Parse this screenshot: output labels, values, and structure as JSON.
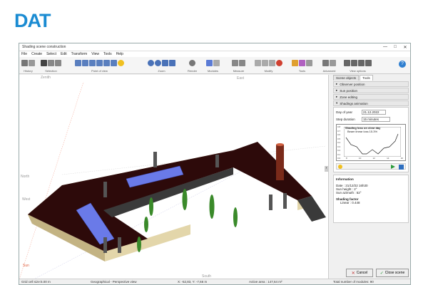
{
  "logo": "DAT",
  "window": {
    "title": "Shading scene construction",
    "controls": [
      "—",
      "□",
      "✕"
    ]
  },
  "menu": [
    "File",
    "Create",
    "Select",
    "Edit",
    "Transform",
    "View",
    "Tools",
    "Help"
  ],
  "toolbar_groups": [
    "History",
    "Selection",
    "Point of view",
    "Zoom",
    "Render",
    "Modules",
    "Measure",
    "Modify",
    "Tools",
    "Advanced",
    "View options"
  ],
  "viewport": {
    "zenith": "Zenith",
    "east": "East",
    "north": "North",
    "west": "West",
    "south": "South",
    "sun": "Sun"
  },
  "side": {
    "tabs": [
      "Scene objects",
      "Tools"
    ],
    "sections": [
      "Observer position",
      "Sun position",
      "Zone editing",
      "Shadings animation"
    ],
    "day_label": "Day of year",
    "day_value": "21.12.2022",
    "step_label": "Step duration",
    "step_value": "15 minutes",
    "graph_title": "Shading loss on clear day",
    "graph_subtitle": "Beam linear loss 15.3%",
    "y_ticks": [
      "0.8",
      "0.7",
      "0.6",
      "0.5",
      "0.4",
      "0.3",
      "0.2",
      "0.1",
      "0.0"
    ],
    "x_ticks": [
      "8",
      "10",
      "12",
      "14",
      "16"
    ],
    "info_title": "Information",
    "info_date": "Date : 21/12/22 16h30",
    "info_height": "Sun height : 2°",
    "info_azimuth": "Sun azimuth : 52°",
    "shading_title": "Shading factor",
    "shading_value": "Linear : 0.448"
  },
  "buttons": {
    "cancel": "Cancel",
    "close": "Close scene"
  },
  "status": {
    "grid": "Grid cell size:",
    "grid_val": "5.00 m",
    "view": "Geographical - Perspective view",
    "coords": "X: -52,83, Y: -7,66 m",
    "area": "Active area : 147,64 m²",
    "modules": "Total number of modules: 90"
  }
}
